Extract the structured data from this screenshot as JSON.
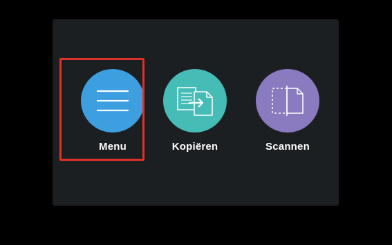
{
  "tiles": [
    {
      "label": "Menu",
      "icon": "hamburger-menu-icon",
      "color": "#3d9ee0"
    },
    {
      "label": "Kopiëren",
      "icon": "copy-document-icon",
      "color": "#45bdb6"
    },
    {
      "label": "Scannen",
      "icon": "scan-document-icon",
      "color": "#8a7ac0"
    }
  ],
  "highlight": {
    "target": "Menu",
    "color": "#e0302a"
  },
  "colors": {
    "background": "#000000",
    "panel": "#1c1f22",
    "label": "#ffffff"
  }
}
